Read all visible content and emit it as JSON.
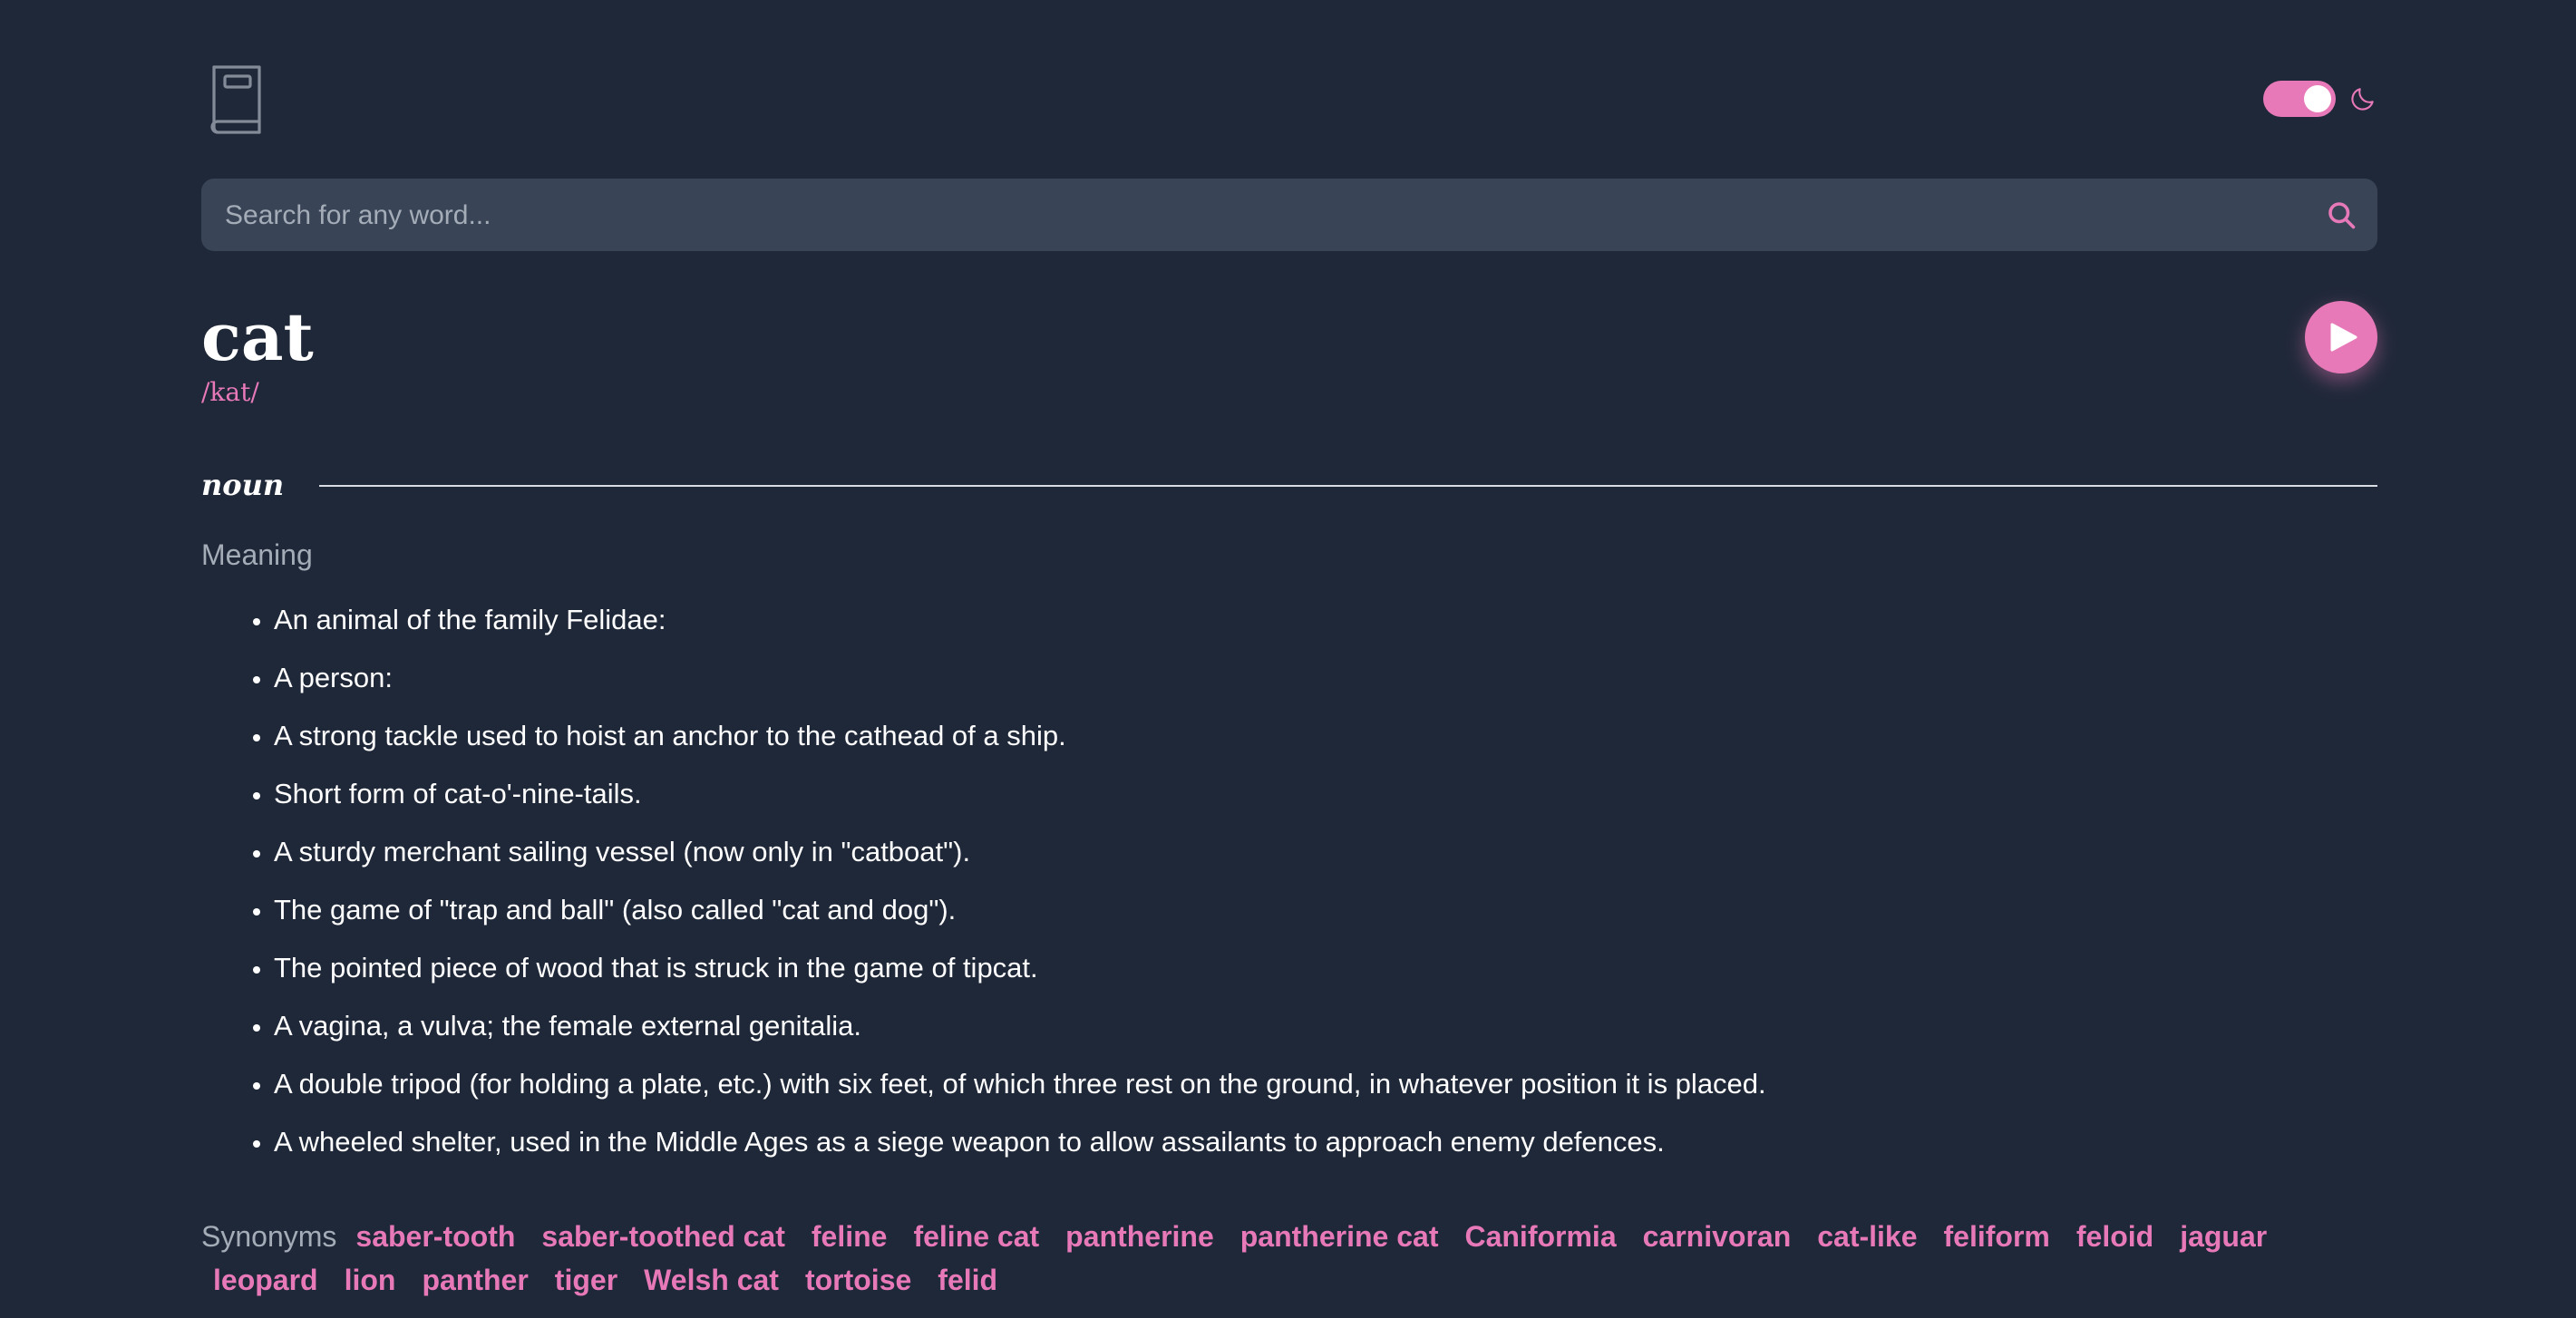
{
  "header": {
    "logo_icon": "book-icon",
    "theme_toggle_on": true,
    "theme_icon": "moon-icon"
  },
  "search": {
    "placeholder": "Search for any word...",
    "value": "",
    "icon": "search-icon"
  },
  "entry": {
    "word": "cat",
    "phonetic": "/kat/",
    "play_icon": "play-icon"
  },
  "meaning_section": {
    "part_of_speech": "noun",
    "meaning_label": "Meaning",
    "definitions": [
      "An animal of the family Felidae:",
      "A person:",
      "A strong tackle used to hoist an anchor to the cathead of a ship.",
      "Short form of cat-o'-nine-tails.",
      "A sturdy merchant sailing vessel (now only in \"catboat\").",
      "The game of \"trap and ball\" (also called \"cat and dog\").",
      "The pointed piece of wood that is struck in the game of tipcat.",
      "A vagina, a vulva; the female external genitalia.",
      "A double tripod (for holding a plate, etc.) with six feet, of which three rest on the ground, in whatever position it is placed.",
      "A wheeled shelter, used in the Middle Ages as a siege weapon to allow assailants to approach enemy defences."
    ],
    "synonyms_label": "Synonyms",
    "synonyms": [
      "saber-tooth",
      "saber-toothed cat",
      "feline",
      "feline cat",
      "pantherine",
      "pantherine cat",
      "Caniformia",
      "carnivoran",
      "cat-like",
      "feliform",
      "feloid",
      "jaguar",
      "leopard",
      "lion",
      "panther",
      "tiger",
      "Welsh cat",
      "tortoise",
      "felid"
    ]
  },
  "colors": {
    "background": "#1f2839",
    "accent": "#e879b9",
    "search_bg": "#394557",
    "muted_text": "#a4acb8"
  }
}
